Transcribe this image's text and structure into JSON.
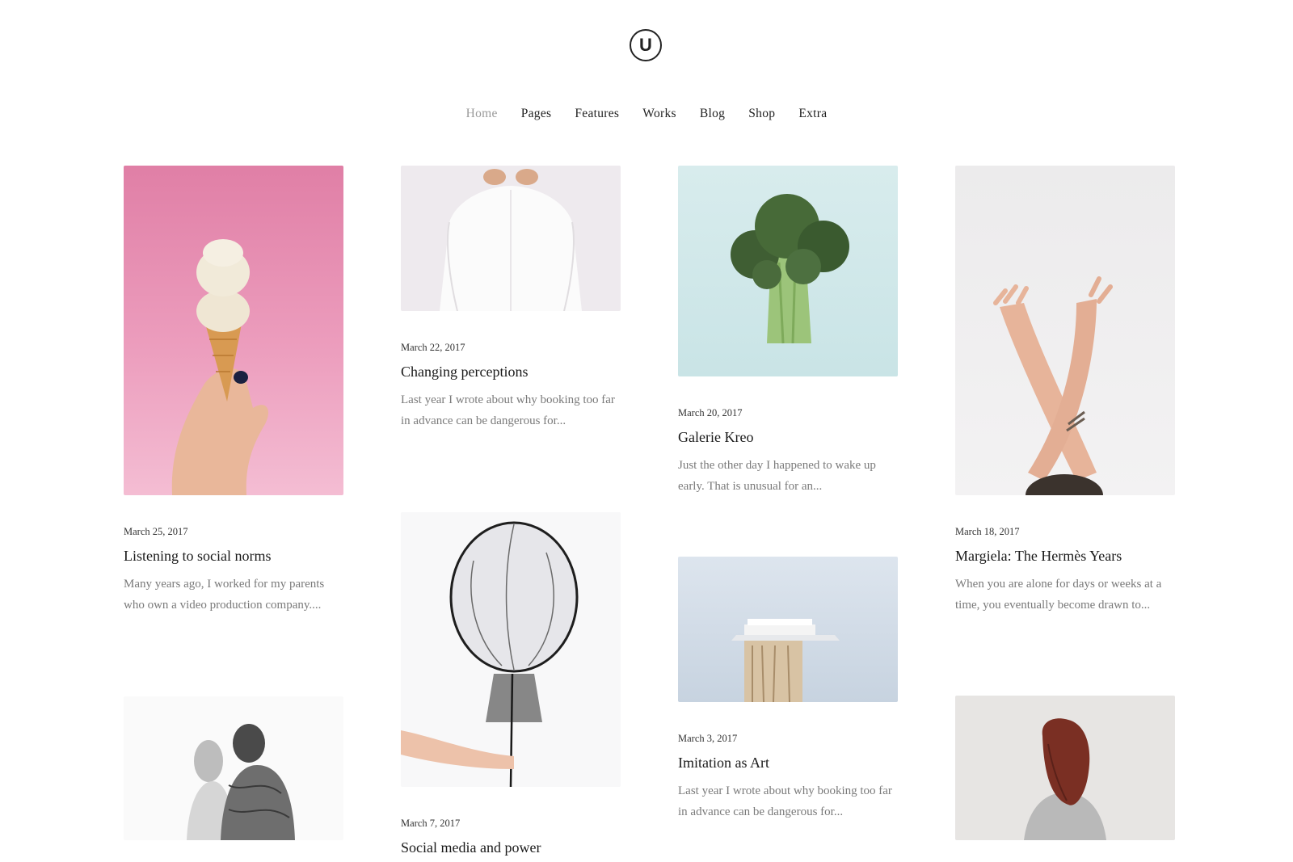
{
  "logo": {
    "letter": "U"
  },
  "nav": {
    "items": [
      "Home",
      "Pages",
      "Features",
      "Works",
      "Blog",
      "Shop",
      "Extra"
    ],
    "active": "Home"
  },
  "posts": [
    {
      "date": "March 25, 2017",
      "title": "Listening to social norms",
      "excerpt": "Many years ago, I worked for my parents who own a video production company...."
    },
    {
      "date": "March 22, 2017",
      "title": "Changing perceptions",
      "excerpt": "Last year I wrote about why booking too far in advance can be dangerous for..."
    },
    {
      "date": "March 20, 2017",
      "title": "Galerie Kreo",
      "excerpt": "Just the other day I happened to wake up early. That is unusual for an..."
    },
    {
      "date": "March 18, 2017",
      "title": "Margiela: The Hermès Years",
      "excerpt": "When you are alone for days or weeks at a time, you eventually become drawn to..."
    },
    {
      "date": "March 7, 2017",
      "title": "Social media and power",
      "excerpt": ""
    },
    {
      "date": "March 3, 2017",
      "title": "Imitation as Art",
      "excerpt": "Last year I wrote about why booking too far in advance can be dangerous for..."
    }
  ]
}
